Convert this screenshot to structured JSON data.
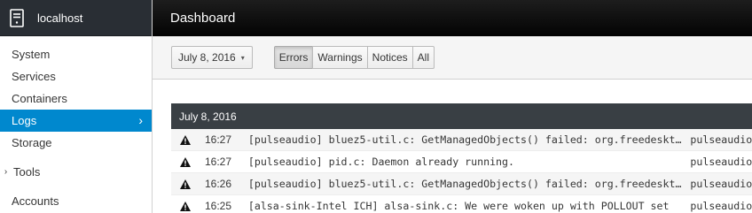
{
  "host": {
    "name": "localhost",
    "icon": "server-icon"
  },
  "nav": {
    "items": [
      {
        "label": "System"
      },
      {
        "label": "Services"
      },
      {
        "label": "Containers"
      },
      {
        "label": "Logs",
        "active": true
      },
      {
        "label": "Storage"
      }
    ],
    "tools_label": "Tools",
    "sub_items": [
      {
        "label": "Accounts"
      }
    ]
  },
  "header": {
    "title": "Dashboard"
  },
  "toolbar": {
    "date_label": "July 8, 2016",
    "priorities": [
      "Errors",
      "Warnings",
      "Notices",
      "All"
    ],
    "active_priority": "Errors"
  },
  "log": {
    "day_heading": "July 8, 2016",
    "entries": [
      {
        "time": "16:27",
        "message": "[pulseaudio] bluez5-util.c: GetManagedObjects() failed: org.freedesktop.DBus.Error.TimedOut",
        "service": "pulseaudio"
      },
      {
        "time": "16:27",
        "message": "[pulseaudio] pid.c: Daemon already running.",
        "service": "pulseaudio"
      },
      {
        "time": "16:26",
        "message": "[pulseaudio] bluez5-util.c: GetManagedObjects() failed: org.freedesktop.DBus.Error.TimedOut",
        "service": "pulseaudio"
      },
      {
        "time": "16:25",
        "message": "[alsa-sink-Intel ICH] alsa-sink.c: We were woken up with POLLOUT set",
        "service": "pulseaudio"
      }
    ]
  },
  "colors": {
    "accent": "#0088ce",
    "topbar": "#030303",
    "sidebar_header": "#292e34"
  }
}
